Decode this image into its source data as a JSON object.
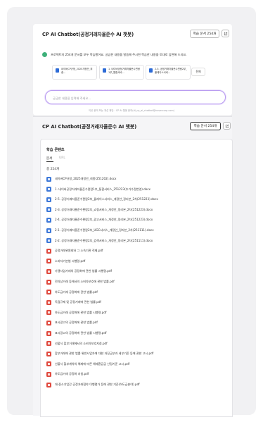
{
  "app": {
    "title": "CP AI Chatbot(공정거래자율준수 AI 챗봇)",
    "doc_button": "학습 문서 254개"
  },
  "intro": {
    "message": "프로젝트의 254개 문서를 모두 학습했어요. 궁금한 내용을 말씀해 주시면 학습한 내용을 토대로 답변해 드리요."
  },
  "doc_cards": [
    {
      "label": "네이버CP규정_2025개정안_최종..."
    },
    {
      "label": "1. 네이버공정거래자율준수편람1부_통합서비..."
    },
    {
      "label": "2-5. 공정거래자율준수편람2부_플레이스서비..."
    }
  ],
  "all_button": "전체",
  "input": {
    "placeholder": "궁금한 내용을 입력해 주세요..."
  },
  "footer": "이곳 문의 또는 개선 제안 : CP AI 챗봇 문의(dl_cp_ai_chatbot@navercorp.com)",
  "modal": {
    "title": "학습 콘텐츠",
    "tabs": [
      "문서",
      "URL"
    ],
    "total": "총 254개",
    "files": [
      {
        "type": "docx",
        "name": "네이버CP규정_2025개정안_최종(251202).docx"
      },
      {
        "type": "docx",
        "name": "1. 네이버공정거래자율준수편람1부_통합서비스_251223(추가수정반영).docx"
      },
      {
        "type": "docx",
        "name": "2-5. 공정거래자율준수편람2부_플레이스서비스_개정안_정리본_2차(251223).docx"
      },
      {
        "type": "docx",
        "name": "2-3. 공정거래자율준수편람2부_쇼핑서비스_개정안_정리본_2차(251223).docx"
      },
      {
        "type": "docx",
        "name": "2-4. 공정거래자율준수편람2부_광고서비스_개정안_정리본_2차(251223).docx"
      },
      {
        "type": "docx",
        "name": "2-1. 공정거래자율준수편람2부_UGC서비스_개정안_정리본_2차(251111).docx"
      },
      {
        "type": "docx",
        "name": "2-2. 공정거래자율준수편람2부_검색서비스_개정안_정리본_2차(251111).docx"
      },
      {
        "type": "pdf",
        "name": "공정거래위원회와 그 소속기관 직제.pdf"
      },
      {
        "type": "pdf",
        "name": "소비자기본법 시행령.pdf"
      },
      {
        "type": "pdf",
        "name": "가맹사업거래의 공정화에 관한 법률 시행령.pdf"
      },
      {
        "type": "pdf",
        "name": "전자상거래 등에서의 소비자보호에 관한 법률.pdf"
      },
      {
        "type": "pdf",
        "name": "하도급거래 공정화에 관한 법률.pdf"
      },
      {
        "type": "pdf",
        "name": "독점규제 및 공정거래에 관한 법률.pdf"
      },
      {
        "type": "pdf",
        "name": "하도급거래 공정화에 관한 법률 시행령.pdf"
      },
      {
        "type": "pdf",
        "name": "표시광고의 공정화에 관한 법률.pdf"
      },
      {
        "type": "pdf",
        "name": "표시광고의 공정화에 관한 법률 시행령.pdf"
      },
      {
        "type": "pdf",
        "name": "선불식 할부거래에서의 소비자보호지침.pdf"
      },
      {
        "type": "pdf",
        "name": "할부거래에 관한 법률 위반사업자에 대한 과징금부과 세부기준 등에 관한 고시.pdf"
      },
      {
        "type": "pdf",
        "name": "선불식 할부계약의 해제에 따른 해제환급금 산정기준 고시.pdf"
      },
      {
        "type": "pdf",
        "name": "하도급거래 공정화 지침.pdf"
      },
      {
        "type": "pdf",
        "name": "대·중소기업간 공정거래협약 이행평가 등에 관한 기준(하도급분야).pdf"
      }
    ]
  }
}
